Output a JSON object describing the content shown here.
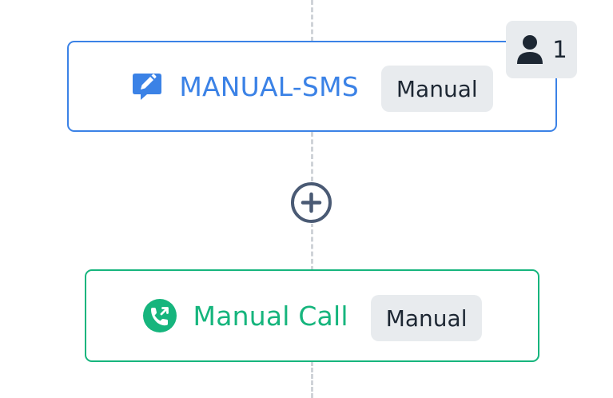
{
  "steps": [
    {
      "label": "MANUAL-SMS",
      "badge": "Manual",
      "icon": "sms-edit-icon",
      "color": "#3b82e6"
    },
    {
      "label": "Manual Call",
      "badge": "Manual",
      "icon": "phone-call-icon",
      "color": "#16b57d"
    }
  ],
  "assignee_badge": {
    "icon": "person-icon",
    "count": "1"
  },
  "add_step": {
    "icon": "plus-circle-icon"
  },
  "colors": {
    "sms_accent": "#3b82e6",
    "call_accent": "#16b57d",
    "badge_bg": "#e8ebee",
    "badge_text": "#1d2733",
    "connector": "#cfd3d8",
    "add_button": "#4a5a74"
  }
}
